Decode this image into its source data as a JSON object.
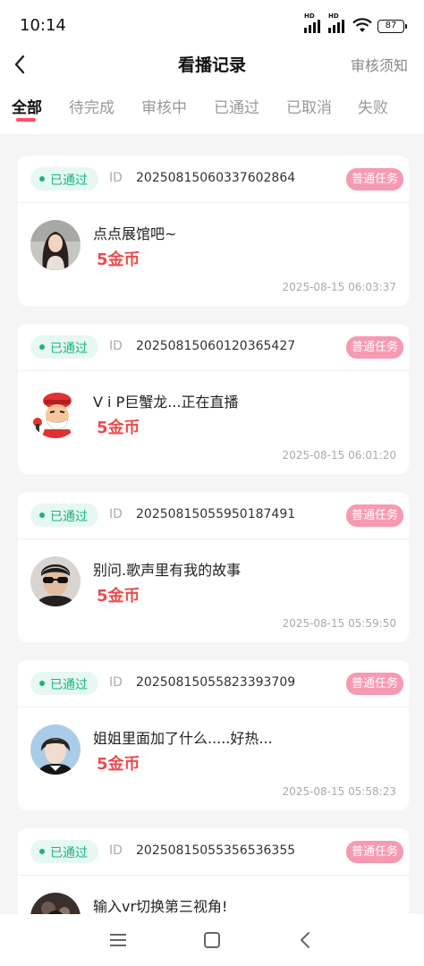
{
  "status": {
    "time": "10:14",
    "hd1": "HD",
    "hd2": "HD",
    "battery": "87"
  },
  "header": {
    "title": "看播记录",
    "rule_link": "审核须知"
  },
  "tabs": [
    {
      "label": "全部",
      "active": true
    },
    {
      "label": "待完成"
    },
    {
      "label": "审核中"
    },
    {
      "label": "已通过"
    },
    {
      "label": "已取消"
    },
    {
      "label": "失败"
    }
  ],
  "records": [
    {
      "status": "已通过",
      "id_label": "ID",
      "id": "20250815060337602864",
      "tag": "普通任务",
      "name": "点点展馆吧~",
      "reward": "5金币",
      "time": "2025-08-15 06:03:37",
      "avatar": "avatar-woman"
    },
    {
      "status": "已通过",
      "id_label": "ID",
      "id": "20250815060120365427",
      "tag": "普通任务",
      "name": "V i P巨蟹龙...正在直播",
      "reward": "5金币",
      "time": "2025-08-15 06:01:20",
      "avatar": "avatar-cartoon"
    },
    {
      "status": "已通过",
      "id_label": "ID",
      "id": "20250815055950187491",
      "tag": "普通任务",
      "name": "别问.歌声里有我的故事",
      "reward": "5金币",
      "time": "2025-08-15 05:59:50",
      "avatar": "avatar-man-sunglasses"
    },
    {
      "status": "已通过",
      "id_label": "ID",
      "id": "20250815055823393709",
      "tag": "普通任务",
      "name": "姐姐里面加了什么.....好热...",
      "reward": "5金币",
      "time": "2025-08-15 05:58:23",
      "avatar": "avatar-boy"
    },
    {
      "status": "已通过",
      "id_label": "ID",
      "id": "20250815055356536355",
      "tag": "普通任务",
      "name": "输入vr切换第三视角!",
      "avatar": "avatar-dark"
    }
  ],
  "icons": {
    "back": "back-arrow-icon",
    "nav_menu": "menu-icon",
    "nav_home": "home-icon",
    "nav_back": "nav-back-icon"
  },
  "colors": {
    "accent": "#ff4d6a",
    "success": "#19b37d",
    "reward": "#ef4b4b",
    "tag": "#f69ab2"
  }
}
